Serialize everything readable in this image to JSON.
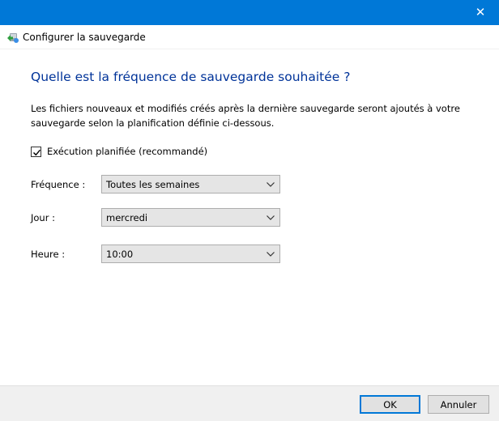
{
  "window": {
    "close_glyph": "✕",
    "title": "Configurer la sauvegarde",
    "app_icon": "backup-icon"
  },
  "content": {
    "heading": "Quelle est la fréquence de sauvegarde souhaitée ?",
    "description": "Les fichiers nouveaux et modifiés créés après la dernière sauvegarde seront ajoutés à votre sauvegarde selon la planification définie ci-dessous.",
    "scheduled_checkbox": {
      "label": "Exécution planifiée (recommandé)",
      "checked": true
    },
    "frequency": {
      "label": "Fréquence :",
      "value": "Toutes les semaines"
    },
    "day": {
      "label": "Jour :",
      "value": "mercredi"
    },
    "time": {
      "label": "Heure :",
      "value": "10:00"
    }
  },
  "footer": {
    "ok_label": "OK",
    "cancel_label": "Annuler"
  },
  "colors": {
    "titlebar": "#0078d7",
    "heading": "#003399",
    "footer": "#f0f0f0"
  }
}
